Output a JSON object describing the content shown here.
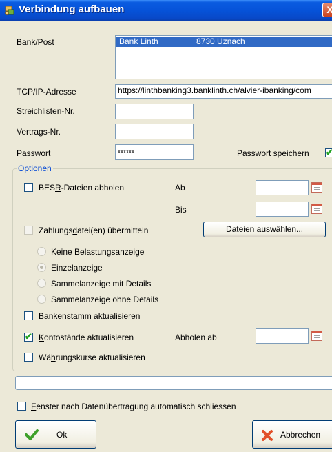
{
  "window": {
    "title": "Verbindung aufbauen",
    "close_label": "X"
  },
  "bank": {
    "label": "Bank/Post",
    "selected_name": "Bank Linth",
    "selected_location": "8730 Uznach"
  },
  "tcp": {
    "label": "TCP/IP-Adresse",
    "value": "https://linthbanking3.banklinth.ch/alvier-ibanking/com"
  },
  "streichliste": {
    "label": "Streichlisten-Nr.",
    "value": ""
  },
  "vertrag": {
    "label": "Vertrags-Nr.",
    "value": ""
  },
  "passwort": {
    "label": "Passwort",
    "value": "xxxxxx",
    "save_label_pre": "Passwort speicher",
    "save_label_u": "n",
    "save_checked": true
  },
  "optionen": {
    "legend": "Optionen",
    "besr": {
      "pre": "BES",
      "u": "R",
      "post": "-Dateien abholen",
      "checked": false
    },
    "ab_label": "Ab",
    "bis_label": "Bis",
    "zahlung": {
      "pre": "Zahlungs",
      "u": "d",
      "post": "atei(en) übermitteln",
      "checked": false
    },
    "dateien_button": "Dateien auswählen...",
    "radios": [
      {
        "label": "Keine Belastungsanzeige",
        "selected": false
      },
      {
        "label": "Einzelanzeige",
        "selected": true
      },
      {
        "label": "Sammelanzeige mit Details",
        "selected": false
      },
      {
        "label": "Sammelanzeige ohne Details",
        "selected": false
      }
    ],
    "bankenstamm": {
      "u": "B",
      "post": "ankenstamm aktualisieren",
      "checked": false
    },
    "konto": {
      "u": "K",
      "post": "ontostände aktualisieren",
      "checked": true
    },
    "abholen_ab_label": "Abholen ab",
    "waehrung": {
      "pre": "Wä",
      "u": "h",
      "post": "rungskurse aktualisieren",
      "checked": false
    }
  },
  "fenster": {
    "u": "F",
    "post": "enster nach Datenübertragung automatisch schliessen",
    "checked": false
  },
  "ok_button": "Ok",
  "cancel_button": "Abbrechen"
}
